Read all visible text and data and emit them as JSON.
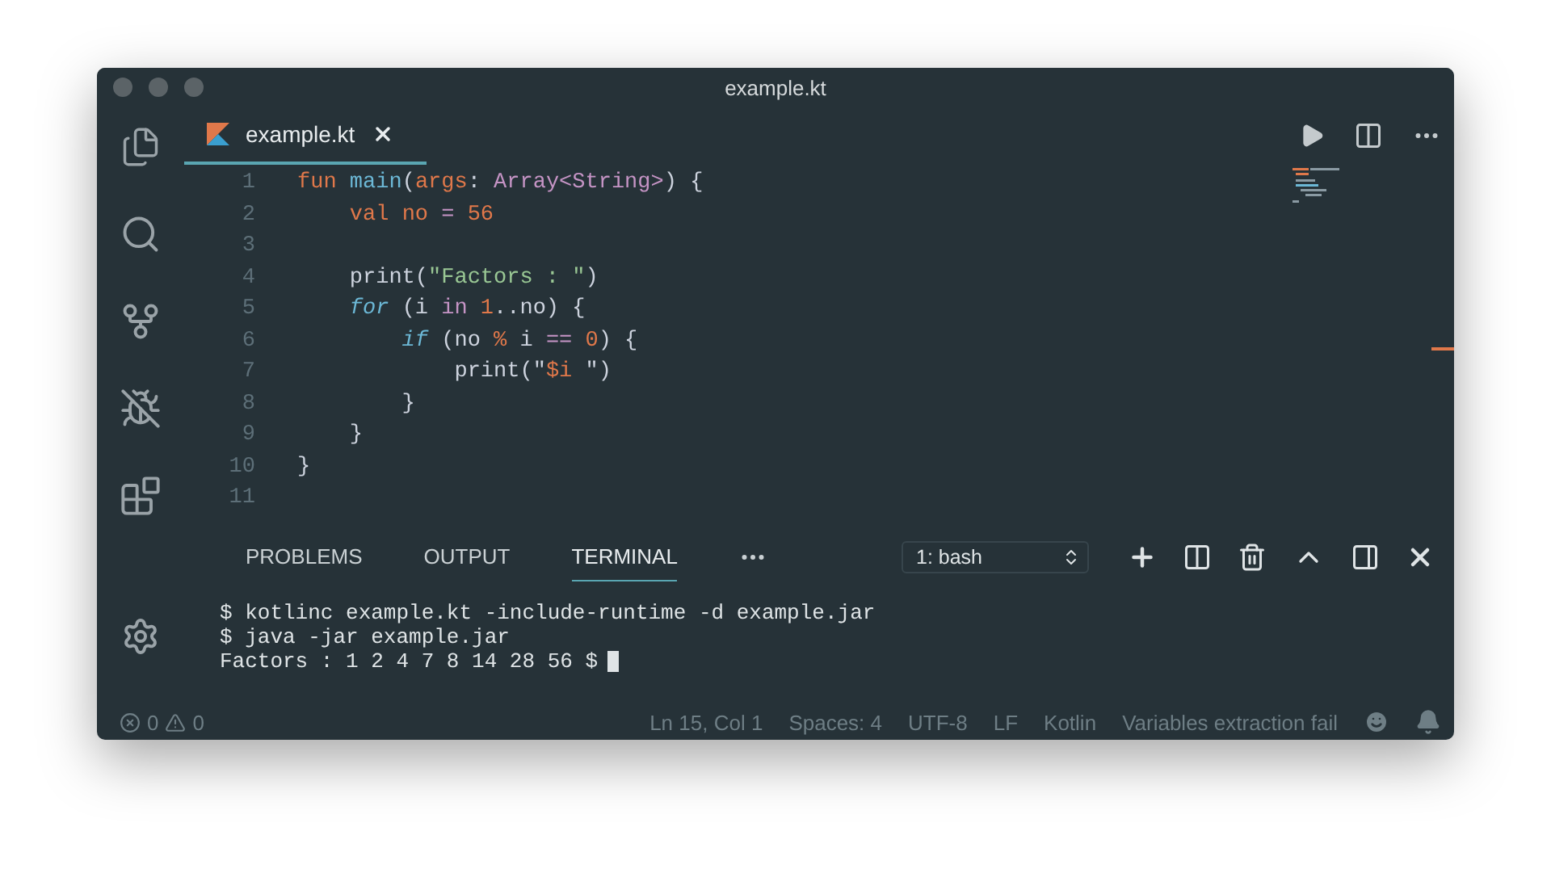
{
  "window": {
    "title": "example.kt"
  },
  "tabs": [
    {
      "label": "example.kt",
      "selected": true
    }
  ],
  "editor": {
    "lines": [
      {
        "number": "1",
        "tokens": [
          {
            "kind": "keyword",
            "text": "fun"
          },
          {
            "kind": "function",
            "text": " main"
          },
          {
            "kind": "plain",
            "text": "("
          },
          {
            "kind": "param",
            "text": "args"
          },
          {
            "kind": "plain",
            "text": ": "
          },
          {
            "kind": "type",
            "text": "Array<String>"
          },
          {
            "kind": "plain",
            "text": ") {"
          }
        ]
      },
      {
        "number": "2",
        "tokens": [
          {
            "kind": "keyword",
            "text": "    val"
          },
          {
            "kind": "param",
            "text": " no"
          },
          {
            "kind": "operator",
            "text": " ="
          },
          {
            "kind": "number",
            "text": " 56"
          }
        ]
      },
      {
        "number": "3"
      },
      {
        "number": "4",
        "tokens": [
          {
            "kind": "plain",
            "text": "    print("
          },
          {
            "kind": "string",
            "text": "\"Factors : \""
          },
          {
            "kind": "plain",
            "text": ")"
          }
        ]
      },
      {
        "number": "5",
        "tokens": [
          {
            "kind": "control",
            "text": "    for"
          },
          {
            "kind": "plain",
            "text": " (i "
          },
          {
            "kind": "type",
            "text": "in"
          },
          {
            "kind": "number",
            "text": " 1"
          },
          {
            "kind": "plain",
            "text": "..no) {"
          }
        ]
      },
      {
        "number": "6",
        "tokens": [
          {
            "kind": "control",
            "text": "        if"
          },
          {
            "kind": "plain",
            "text": " (no "
          },
          {
            "kind": "param",
            "text": "%"
          },
          {
            "kind": "plain",
            "text": " i "
          },
          {
            "kind": "type",
            "text": "=="
          },
          {
            "kind": "number",
            "text": " 0"
          },
          {
            "kind": "plain",
            "text": ") {"
          }
        ]
      },
      {
        "number": "7",
        "tokens": [
          {
            "kind": "plain",
            "text": "            print(\""
          },
          {
            "kind": "param",
            "text": "$i"
          },
          {
            "kind": "plain",
            "text": " \")"
          }
        ]
      },
      {
        "number": "8",
        "tokens": [
          {
            "kind": "plain",
            "text": "        }"
          }
        ]
      },
      {
        "number": "9",
        "tokens": [
          {
            "kind": "plain",
            "text": "    }"
          }
        ]
      },
      {
        "number": "10",
        "tokens": [
          {
            "kind": "plain",
            "text": "}"
          }
        ]
      },
      {
        "number": "11"
      }
    ]
  },
  "panel": {
    "tabs": [
      {
        "label": "PROBLEMS",
        "selected": false
      },
      {
        "label": "OUTPUT",
        "selected": false
      },
      {
        "label": "TERMINAL",
        "selected": true
      }
    ],
    "terminal_select": "1: bash",
    "terminal_lines": [
      "$ kotlinc example.kt -include-runtime -d example.jar",
      "$ java -jar example.jar",
      "Factors : 1 2 4 7 8 14 28 56 $"
    ]
  },
  "status_bar": {
    "errors": "0",
    "warnings": "0",
    "items": [
      "Ln 15, Col 1",
      "Spaces: 4",
      "UTF-8",
      "LF",
      "Kotlin",
      "Variables extraction fail"
    ]
  }
}
